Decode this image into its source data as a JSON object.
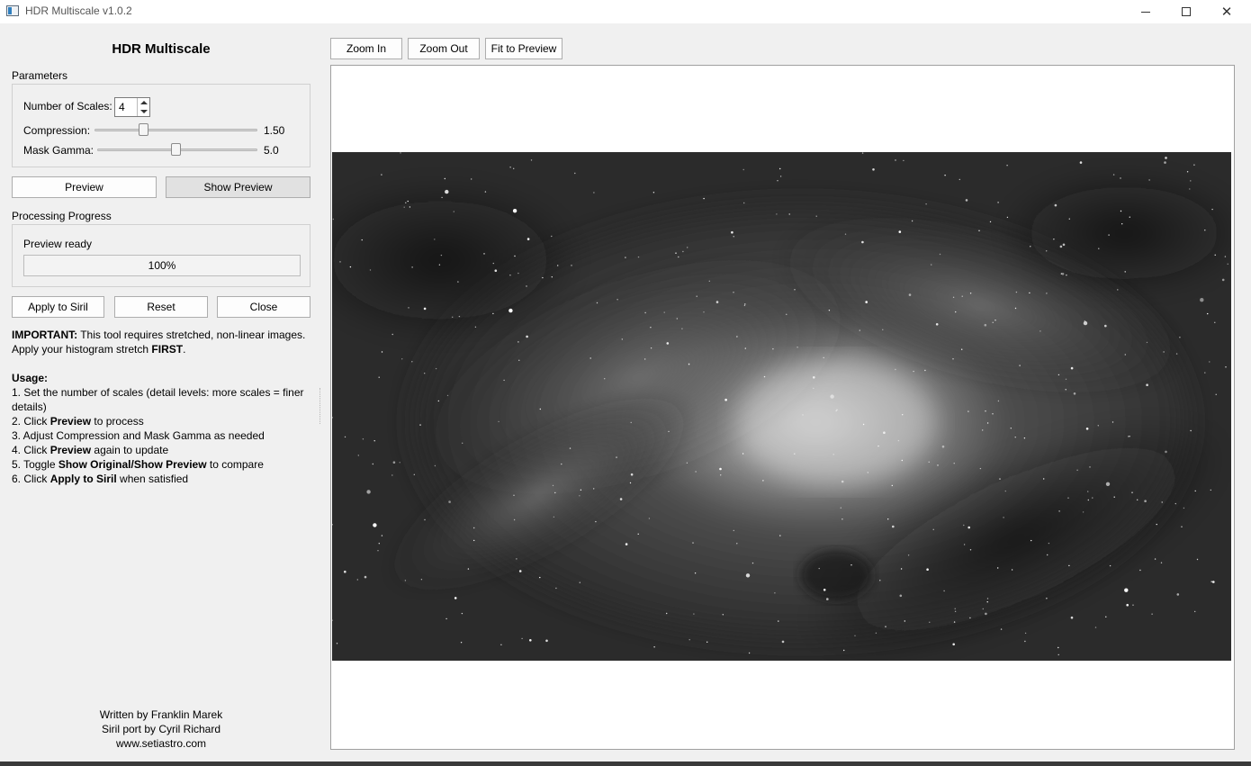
{
  "window": {
    "title": "HDR Multiscale v1.0.2",
    "minimize": "minimize-icon",
    "maximize": "maximize-icon",
    "close": "✕"
  },
  "panel": {
    "title": "HDR Multiscale",
    "parameters_label": "Parameters",
    "scales_label": "Number of Scales:",
    "scales_value": "4",
    "compression_label": "Compression:",
    "compression_value": "1.50",
    "compression_fraction": 0.3,
    "mask_gamma_label": "Mask Gamma:",
    "mask_gamma_value": "5.0",
    "mask_gamma_fraction": 0.49,
    "preview_button": "Preview",
    "show_preview_button": "Show Preview",
    "progress_label": "Processing Progress",
    "status_text": "Preview ready",
    "progress_text": "100%",
    "progress_fraction": 1.0,
    "apply_button": "Apply to Siril",
    "reset_button": "Reset",
    "close_button": "Close"
  },
  "info": {
    "important_bold": "IMPORTANT:",
    "important_text": " This tool requires stretched, non-linear images.",
    "apply_text": "Apply your histogram stretch ",
    "apply_bold": "FIRST",
    "apply_end": ".",
    "usage_title": "Usage:",
    "step1": "1. Set the number of scales (detail levels: more scales = finer details)",
    "step2_a": "2. Click ",
    "step2_b": "Preview",
    "step2_c": " to process",
    "step3": "3. Adjust Compression and Mask Gamma as needed",
    "step4_a": "4. Click ",
    "step4_b": "Preview",
    "step4_c": " again to update",
    "step5_a": "5. Toggle ",
    "step5_b": "Show Original/Show Preview",
    "step5_c": " to compare",
    "step6_a": "6. Click ",
    "step6_b": "Apply to Siril",
    "step6_c": " when satisfied"
  },
  "credits": {
    "line1": "Written by Franklin Marek",
    "line2": "Siril port by Cyril Richard",
    "line3": "www.setiastro.com"
  },
  "toolbar": {
    "zoom_in": "Zoom In",
    "zoom_out": "Zoom Out",
    "fit": "Fit to Preview"
  },
  "colors": {
    "background": "#f0f0f0",
    "nebula_dark": "#2a2a2a",
    "nebula_bright": "#d8d8d8"
  }
}
